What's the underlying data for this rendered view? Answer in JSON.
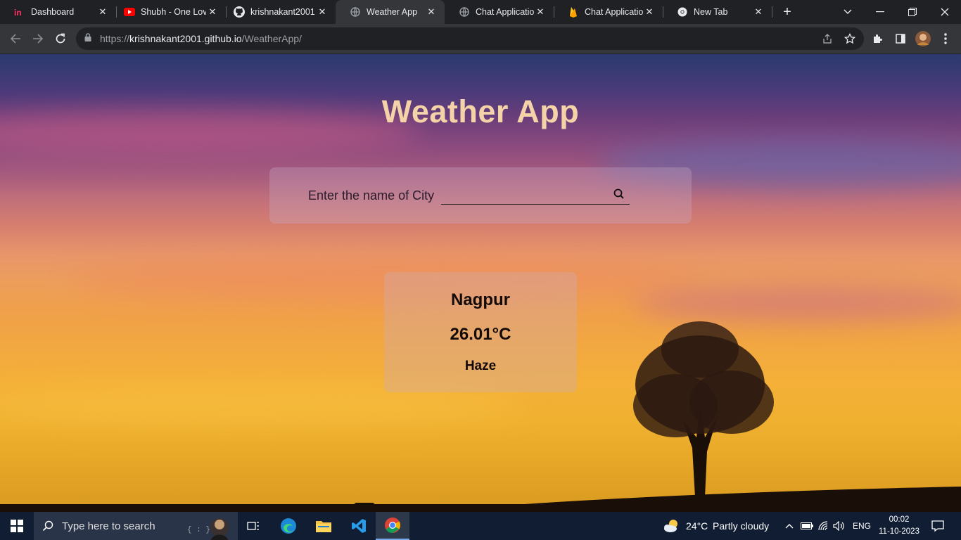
{
  "browser": {
    "tabs": [
      {
        "title": "Dashboard",
        "icon": "invision-icon",
        "active": false
      },
      {
        "title": "Shubh - One Lov",
        "icon": "youtube-icon",
        "active": false
      },
      {
        "title": "krishnakant2001",
        "icon": "github-icon",
        "active": false
      },
      {
        "title": "Weather App",
        "icon": "globe-icon",
        "active": true
      },
      {
        "title": "Chat Application",
        "icon": "globe-icon",
        "active": false
      },
      {
        "title": "Chat Application",
        "icon": "firebase-icon",
        "active": false
      },
      {
        "title": "New Tab",
        "icon": "chrome-icon",
        "active": false
      }
    ],
    "url_prefix": "https://",
    "url_host": "krishnakant2001.github.io",
    "url_path": "/WeatherApp/"
  },
  "page": {
    "title": "Weather App",
    "search_label": "Enter the name of City",
    "search_value": "",
    "weather": {
      "city": "Nagpur",
      "temperature": "26.01°C",
      "description": "Haze"
    }
  },
  "taskbar": {
    "search_placeholder": "Type here to search",
    "weather_temp": "24°C",
    "weather_desc": "Partly cloudy",
    "language": "ENG",
    "time": "00:02",
    "date": "11-10-2023"
  },
  "colors": {
    "title": "#f5d3a8",
    "tabstrip": "#202124",
    "toolbar": "#35363a",
    "taskbar": "#101d33"
  }
}
